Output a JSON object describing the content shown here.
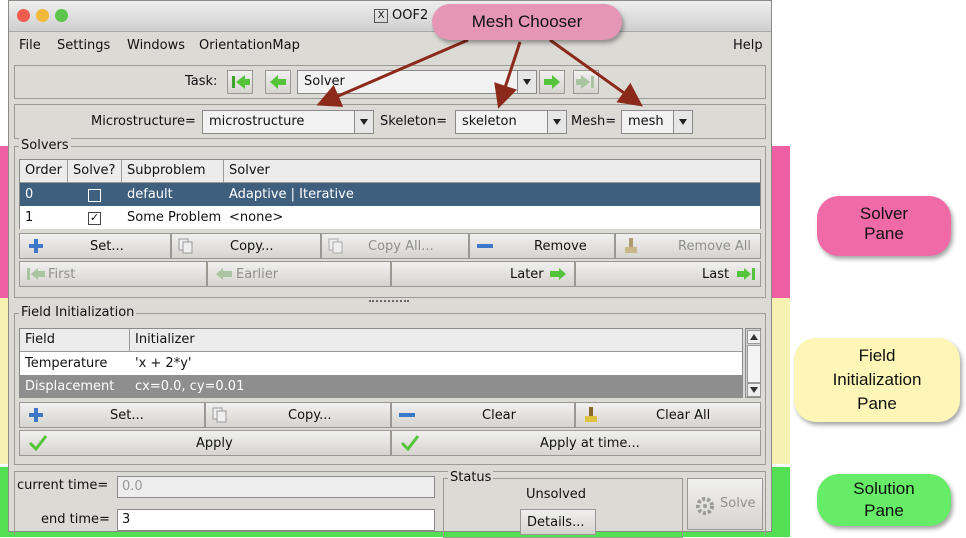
{
  "window": {
    "title": "OOF2",
    "title_icon": "X"
  },
  "menubar": {
    "items": [
      "File",
      "Settings",
      "Windows",
      "OrientationMap"
    ],
    "help": "Help"
  },
  "task_bar": {
    "label": "Task:",
    "value": "Solver"
  },
  "chooser": {
    "microstructure_label": "Microstructure=",
    "microstructure_value": "microstructure",
    "skeleton_label": "Skeleton=",
    "skeleton_value": "skeleton",
    "mesh_label": "Mesh=",
    "mesh_value": "mesh"
  },
  "solvers": {
    "title": "Solvers",
    "columns": [
      "Order",
      "Solve?",
      "Subproblem",
      "Solver"
    ],
    "rows": [
      {
        "order": "0",
        "solve": false,
        "subproblem": "default",
        "solver": "Adaptive | Iterative"
      },
      {
        "order": "1",
        "solve": true,
        "subproblem": "Some Problem",
        "solver": "<none>"
      }
    ],
    "buttons": {
      "set": "Set...",
      "copy": "Copy...",
      "copy_all": "Copy All...",
      "remove": "Remove",
      "remove_all": "Remove All"
    },
    "nav": {
      "first": "First",
      "earlier": "Earlier",
      "later": "Later",
      "last": "Last"
    }
  },
  "field_init": {
    "title": "Field Initialization",
    "columns": [
      "Field",
      "Initializer"
    ],
    "rows": [
      {
        "field": "Temperature",
        "initializer": "'x + 2*y'"
      },
      {
        "field": "Displacement",
        "initializer": "cx=0.0, cy=0.01"
      }
    ],
    "buttons": {
      "set": "Set...",
      "copy": "Copy...",
      "clear": "Clear",
      "clear_all": "Clear All",
      "apply": "Apply",
      "apply_at_time": "Apply at time..."
    }
  },
  "solution": {
    "current_time_label": "current time=",
    "current_time_value": "0.0",
    "end_time_label": "end time=",
    "end_time_value": "3",
    "status_title": "Status",
    "status_value": "Unsolved",
    "details_button": "Details...",
    "solve_button": "Solve"
  },
  "callouts": {
    "mesh_chooser": "Mesh Chooser",
    "solver_pane": [
      "Solver",
      "Pane"
    ],
    "field_pane": [
      "Field",
      "Initialization",
      "Pane"
    ],
    "solution_pane": [
      "Solution",
      "Pane"
    ]
  },
  "colors": {
    "solver_band": "#ee5fa4",
    "field_band": "#f8f2b2",
    "solution_band": "#52e052",
    "selected_row": "#3f5f7f",
    "mesh_callout": "#e596b5",
    "arrow": "#8b2a1a"
  }
}
